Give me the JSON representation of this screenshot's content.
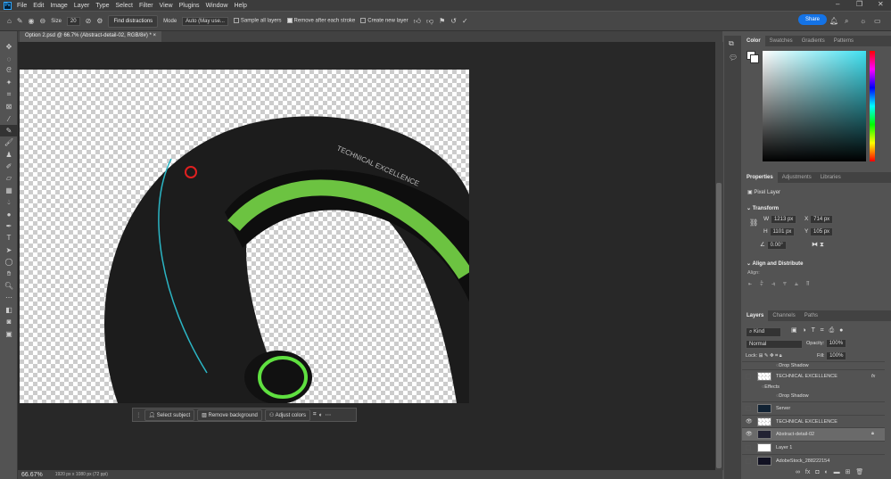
{
  "menu": {
    "logo": "Ps",
    "items": [
      "File",
      "Edit",
      "Image",
      "Layer",
      "Type",
      "Select",
      "Filter",
      "View",
      "Plugins",
      "Window",
      "Help"
    ]
  },
  "options": {
    "size_label": "Size",
    "size_value": "20",
    "find_distractions": "Find distractions",
    "mode_label": "Mode",
    "mode_value": "Auto (May use...",
    "sample_all_layers": "Sample all layers",
    "remove_after_stroke": "Remove after each stroke",
    "create_new_layer": "Create new layer",
    "share": "Share"
  },
  "document": {
    "tab_title": "Option 2.psd @ 66.7% (Abstract-detail-02, RGB/8#) *",
    "image_text": "TECHNICAL EXCELLENCE"
  },
  "contextual_bar": {
    "select_subject": "Select subject",
    "remove_background": "Remove background",
    "adjust_colors": "Adjust colors"
  },
  "status": {
    "zoom": "66.67%",
    "doc_info": "1920 px x 1080 px (72 ppi)"
  },
  "color_panel": {
    "tabs": [
      "Color",
      "Swatches",
      "Gradients",
      "Patterns"
    ],
    "hue_color": "#3fe0f0"
  },
  "properties": {
    "tabs": [
      "Properties",
      "Adjustments",
      "Libraries"
    ],
    "layer_type": "Pixel Layer",
    "transform_title": "Transform",
    "w_label": "W",
    "w": "1213 px",
    "h_label": "H",
    "h": "1101 px",
    "x_label": "X",
    "x": "714 px",
    "y_label": "Y",
    "y": "105 px",
    "angle": "0.00°",
    "align_title": "Align and Distribute",
    "align_label": "Align:"
  },
  "layers": {
    "tabs": [
      "Layers",
      "Channels",
      "Paths"
    ],
    "filter": "Kind",
    "blend": "Normal",
    "opacity_label": "Opacity:",
    "opacity": "100%",
    "lock_label": "Lock:",
    "fill_label": "Fill:",
    "fill": "100%",
    "rows": [
      {
        "name": "Drop Shadow",
        "kind": "effect"
      },
      {
        "name": "TECHNICAL EXCELLENCE",
        "kind": "layer",
        "fx": "fx",
        "visible": false
      },
      {
        "name": "Effects",
        "kind": "effect-head"
      },
      {
        "name": "Drop Shadow",
        "kind": "effect"
      },
      {
        "name": "Server",
        "kind": "layer",
        "visible": false
      },
      {
        "name": "TECHNICAL EXCELLENCE",
        "kind": "layer",
        "visible": true
      },
      {
        "name": "Abstract-detail-02",
        "kind": "layer",
        "visible": true,
        "selected": true
      },
      {
        "name": "Layer 1",
        "kind": "layer",
        "visible": false
      },
      {
        "name": "AdobeStock_288222154",
        "kind": "layer",
        "visible": false
      }
    ]
  }
}
